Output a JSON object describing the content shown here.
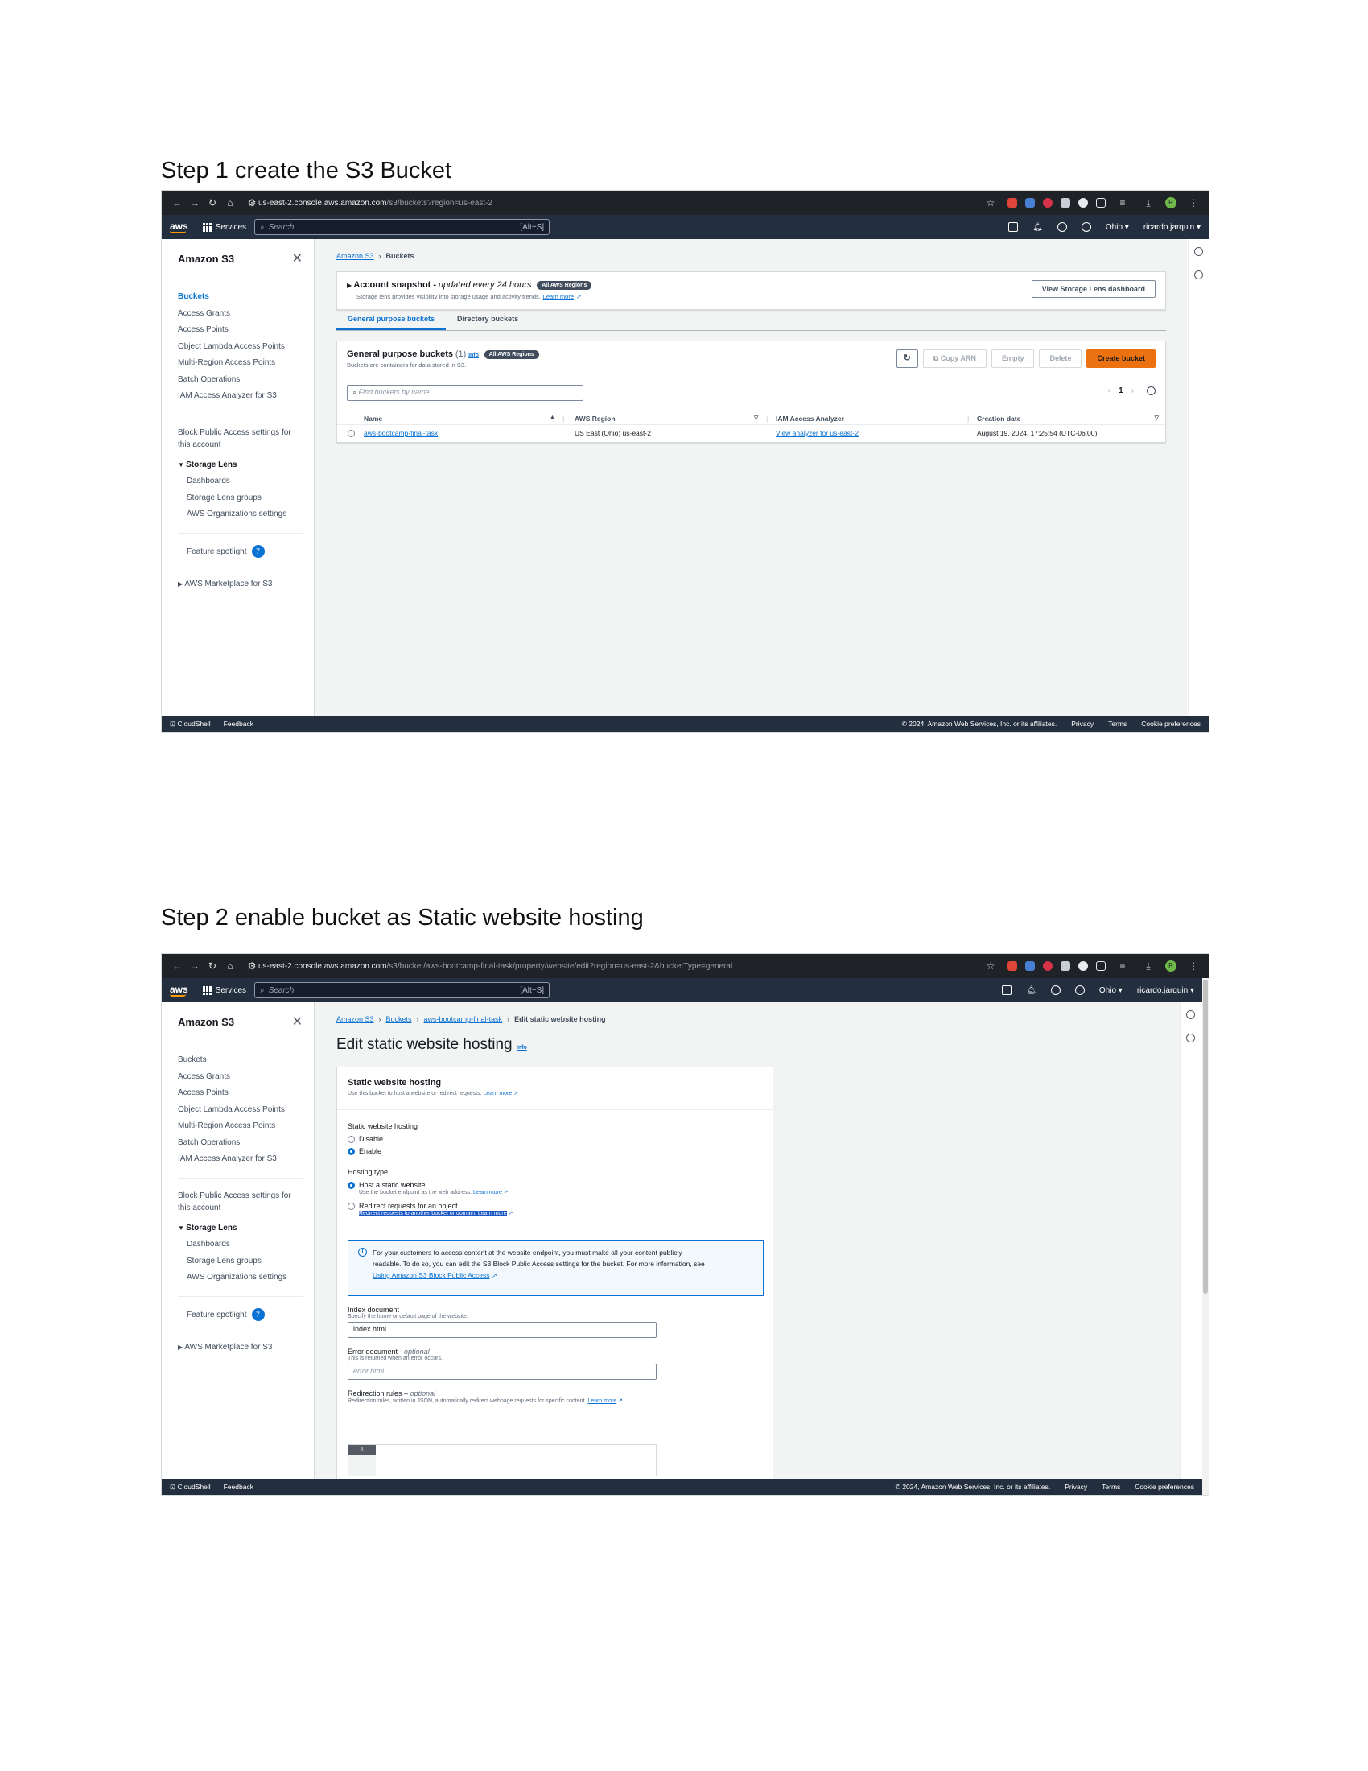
{
  "doc": {
    "step1_title": "Step 1 create the S3 Bucket",
    "step2_title": "Step 2 enable bucket as Static website hosting"
  },
  "colors": {
    "aws_nav": "#232f3e",
    "accent": "#0972d3",
    "orange": "#ec7211",
    "chrome": "#1f2226"
  },
  "shot1": {
    "browser": {
      "url_host": "us-east-2.console.aws.amazon.com",
      "url_path": "/s3/buckets?region=us-east-2"
    },
    "awsnav": {
      "services": "Services",
      "search_placeholder": "Search",
      "search_kbd": "[Alt+S]",
      "region": "Ohio ▾",
      "user": "ricardo.jarquin ▾"
    },
    "sidebar": {
      "title": "Amazon S3",
      "items": [
        "Buckets",
        "Access Grants",
        "Access Points",
        "Object Lambda Access Points",
        "Multi-Region Access Points",
        "Batch Operations",
        "IAM Access Analyzer for S3"
      ],
      "block_public_1": "Block Public Access settings for",
      "block_public_2": "this account",
      "storage_lens": "Storage Lens",
      "lens_items": [
        "Dashboards",
        "Storage Lens groups",
        "AWS Organizations settings"
      ],
      "feature_spotlight": "Feature spotlight",
      "feature_count": "7",
      "marketplace": "AWS Marketplace for S3"
    },
    "breadcrumb": {
      "root": "Amazon S3",
      "current": "Buckets"
    },
    "snapshot": {
      "title": "Account snapshot -",
      "subtitle": "updated every 24 hours",
      "badge": "All AWS Regions",
      "desc": "Storage lens provides visibility into storage usage and activity trends.",
      "learn_more": "Learn more",
      "button": "View Storage Lens dashboard"
    },
    "tabs": [
      "General purpose buckets",
      "Directory buckets"
    ],
    "buckets": {
      "title": "General purpose buckets",
      "count": "(1)",
      "info": "Info",
      "badge": "All AWS Regions",
      "desc": "Buckets are containers for data stored in S3.",
      "copy_arn": "Copy ARN",
      "empty": "Empty",
      "delete": "Delete",
      "create": "Create bucket",
      "find_placeholder": "Find buckets by name",
      "page": "1",
      "columns": [
        "Name",
        "AWS Region",
        "IAM Access Analyzer",
        "Creation date"
      ],
      "rows": [
        {
          "name": "aws-bootcamp-final-task",
          "region": "US East (Ohio) us-east-2",
          "analyzer": "View analyzer for us-east-2",
          "created": "August 19, 2024, 17:25:54 (UTC-06:00)"
        }
      ]
    },
    "footer": {
      "cloudshell": "CloudShell",
      "feedback": "Feedback",
      "copyright": "© 2024, Amazon Web Services, Inc. or its affiliates.",
      "privacy": "Privacy",
      "terms": "Terms",
      "cookies": "Cookie preferences"
    }
  },
  "shot2": {
    "browser": {
      "url_host": "us-east-2.console.aws.amazon.com",
      "url_path": "/s3/bucket/aws-bootcamp-final-task/property/website/edit?region=us-east-2&bucketType=general"
    },
    "breadcrumb": {
      "root": "Amazon S3",
      "buckets": "Buckets",
      "bucket": "aws-bootcamp-final-task",
      "current": "Edit static website hosting"
    },
    "page_title": "Edit static website hosting",
    "info": "Info",
    "form": {
      "section_title": "Static website hosting",
      "section_desc": "Use this bucket to host a website or redirect requests.",
      "learn_more": "Learn more",
      "hosting_label": "Static website hosting",
      "opt_disable": "Disable",
      "opt_enable": "Enable",
      "hosting_type_label": "Hosting type",
      "opt_host": "Host a static website",
      "opt_host_desc": "Use the bucket endpoint as the web address.",
      "opt_redirect": "Redirect requests for an object",
      "opt_redirect_desc": "Redirect requests to another bucket or domain. Learn more",
      "alert_line1": "For your customers to access content at the website endpoint, you must make all your content publicly",
      "alert_line2": "readable. To do so, you can edit the S3 Block Public Access settings for the bucket. For more information, see",
      "alert_link": "Using Amazon S3 Block Public Access",
      "index_label": "Index document",
      "index_desc": "Specify the home or default page of the website.",
      "index_value": "index.html",
      "error_label": "Error document -",
      "error_optional": "optional",
      "error_desc": "This is returned when an error occurs.",
      "error_placeholder": "error.html",
      "redir_label": "Redirection rules –",
      "redir_optional": "optional",
      "redir_desc": "Redirection rules, written in JSON, automatically redirect webpage requests for specific content.",
      "line_no": "1"
    }
  }
}
